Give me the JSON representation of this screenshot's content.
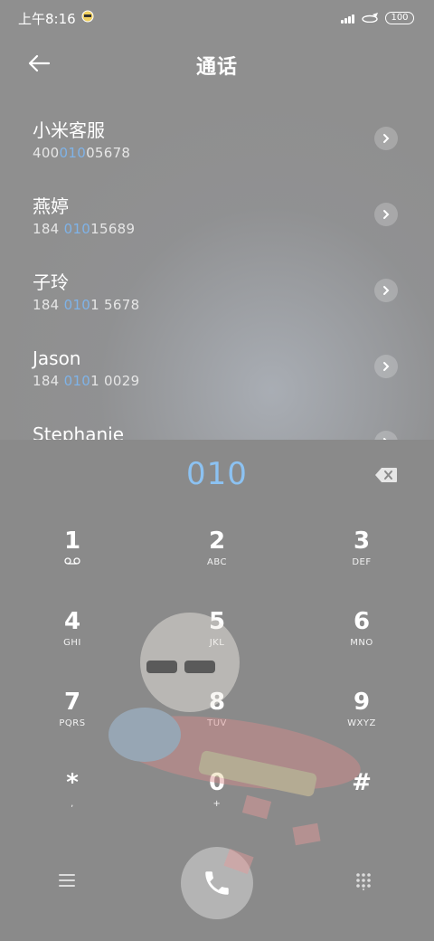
{
  "status": {
    "time": "上午8:16",
    "battery": "100"
  },
  "header": {
    "title": "通话"
  },
  "contacts": [
    {
      "name": "小米客服",
      "num_pre": "400",
      "num_match": "010",
      "num_post": "05678"
    },
    {
      "name": "燕婷",
      "num_pre": "184 ",
      "num_match": "010",
      "num_post": "15689"
    },
    {
      "name": "子玲",
      "num_pre": "184 ",
      "num_match": "010",
      "num_post": "1 5678"
    },
    {
      "name": "Jason",
      "num_pre": "184 ",
      "num_match": "010",
      "num_post": "1 0029"
    },
    {
      "name": "Stephanie",
      "num_pre": "",
      "num_match": "",
      "num_post": ""
    }
  ],
  "dial": {
    "input": "010"
  },
  "keys": [
    {
      "digit": "1",
      "letters": ""
    },
    {
      "digit": "2",
      "letters": "ABC"
    },
    {
      "digit": "3",
      "letters": "DEF"
    },
    {
      "digit": "4",
      "letters": "GHI"
    },
    {
      "digit": "5",
      "letters": "JKL"
    },
    {
      "digit": "6",
      "letters": "MNO"
    },
    {
      "digit": "7",
      "letters": "PQRS"
    },
    {
      "digit": "8",
      "letters": "TUV"
    },
    {
      "digit": "9",
      "letters": "WXYZ"
    },
    {
      "digit": "*",
      "letters": ","
    },
    {
      "digit": "0",
      "letters": "+"
    },
    {
      "digit": "#",
      "letters": ""
    }
  ],
  "icons": {
    "back": "back-arrow-icon",
    "chevron": "chevron-right-icon",
    "delete": "backspace-icon",
    "voicemail": "voicemail-icon",
    "menu": "menu-icon",
    "call": "phone-icon",
    "keypad": "dialpad-icon"
  },
  "colors": {
    "match_highlight": "#7fb3e8",
    "dial_input": "#8cc2f2"
  }
}
